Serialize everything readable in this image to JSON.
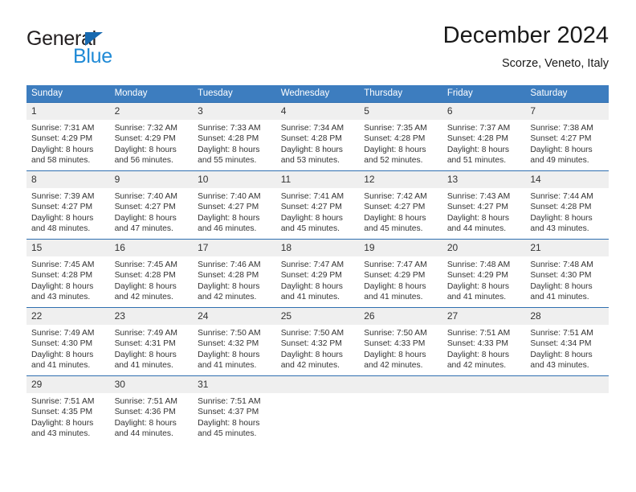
{
  "brand": {
    "name_part1": "General",
    "name_part2": "Blue",
    "triangle_color": "#1769b0",
    "blue_text_color": "#1f8ad6"
  },
  "header": {
    "title": "December 2024",
    "subtitle": "Scorze, Veneto, Italy"
  },
  "theme": {
    "header_bg": "#3d7dbf",
    "row_border": "#2f6fb0",
    "daynum_bg": "#efefef",
    "text": "#333333"
  },
  "weekday_headers": [
    "Sunday",
    "Monday",
    "Tuesday",
    "Wednesday",
    "Thursday",
    "Friday",
    "Saturday"
  ],
  "weeks": [
    [
      {
        "day": "1",
        "sunrise": "Sunrise: 7:31 AM",
        "sunset": "Sunset: 4:29 PM",
        "daylight1": "Daylight: 8 hours",
        "daylight2": "and 58 minutes."
      },
      {
        "day": "2",
        "sunrise": "Sunrise: 7:32 AM",
        "sunset": "Sunset: 4:29 PM",
        "daylight1": "Daylight: 8 hours",
        "daylight2": "and 56 minutes."
      },
      {
        "day": "3",
        "sunrise": "Sunrise: 7:33 AM",
        "sunset": "Sunset: 4:28 PM",
        "daylight1": "Daylight: 8 hours",
        "daylight2": "and 55 minutes."
      },
      {
        "day": "4",
        "sunrise": "Sunrise: 7:34 AM",
        "sunset": "Sunset: 4:28 PM",
        "daylight1": "Daylight: 8 hours",
        "daylight2": "and 53 minutes."
      },
      {
        "day": "5",
        "sunrise": "Sunrise: 7:35 AM",
        "sunset": "Sunset: 4:28 PM",
        "daylight1": "Daylight: 8 hours",
        "daylight2": "and 52 minutes."
      },
      {
        "day": "6",
        "sunrise": "Sunrise: 7:37 AM",
        "sunset": "Sunset: 4:28 PM",
        "daylight1": "Daylight: 8 hours",
        "daylight2": "and 51 minutes."
      },
      {
        "day": "7",
        "sunrise": "Sunrise: 7:38 AM",
        "sunset": "Sunset: 4:27 PM",
        "daylight1": "Daylight: 8 hours",
        "daylight2": "and 49 minutes."
      }
    ],
    [
      {
        "day": "8",
        "sunrise": "Sunrise: 7:39 AM",
        "sunset": "Sunset: 4:27 PM",
        "daylight1": "Daylight: 8 hours",
        "daylight2": "and 48 minutes."
      },
      {
        "day": "9",
        "sunrise": "Sunrise: 7:40 AM",
        "sunset": "Sunset: 4:27 PM",
        "daylight1": "Daylight: 8 hours",
        "daylight2": "and 47 minutes."
      },
      {
        "day": "10",
        "sunrise": "Sunrise: 7:40 AM",
        "sunset": "Sunset: 4:27 PM",
        "daylight1": "Daylight: 8 hours",
        "daylight2": "and 46 minutes."
      },
      {
        "day": "11",
        "sunrise": "Sunrise: 7:41 AM",
        "sunset": "Sunset: 4:27 PM",
        "daylight1": "Daylight: 8 hours",
        "daylight2": "and 45 minutes."
      },
      {
        "day": "12",
        "sunrise": "Sunrise: 7:42 AM",
        "sunset": "Sunset: 4:27 PM",
        "daylight1": "Daylight: 8 hours",
        "daylight2": "and 45 minutes."
      },
      {
        "day": "13",
        "sunrise": "Sunrise: 7:43 AM",
        "sunset": "Sunset: 4:27 PM",
        "daylight1": "Daylight: 8 hours",
        "daylight2": "and 44 minutes."
      },
      {
        "day": "14",
        "sunrise": "Sunrise: 7:44 AM",
        "sunset": "Sunset: 4:28 PM",
        "daylight1": "Daylight: 8 hours",
        "daylight2": "and 43 minutes."
      }
    ],
    [
      {
        "day": "15",
        "sunrise": "Sunrise: 7:45 AM",
        "sunset": "Sunset: 4:28 PM",
        "daylight1": "Daylight: 8 hours",
        "daylight2": "and 43 minutes."
      },
      {
        "day": "16",
        "sunrise": "Sunrise: 7:45 AM",
        "sunset": "Sunset: 4:28 PM",
        "daylight1": "Daylight: 8 hours",
        "daylight2": "and 42 minutes."
      },
      {
        "day": "17",
        "sunrise": "Sunrise: 7:46 AM",
        "sunset": "Sunset: 4:28 PM",
        "daylight1": "Daylight: 8 hours",
        "daylight2": "and 42 minutes."
      },
      {
        "day": "18",
        "sunrise": "Sunrise: 7:47 AM",
        "sunset": "Sunset: 4:29 PM",
        "daylight1": "Daylight: 8 hours",
        "daylight2": "and 41 minutes."
      },
      {
        "day": "19",
        "sunrise": "Sunrise: 7:47 AM",
        "sunset": "Sunset: 4:29 PM",
        "daylight1": "Daylight: 8 hours",
        "daylight2": "and 41 minutes."
      },
      {
        "day": "20",
        "sunrise": "Sunrise: 7:48 AM",
        "sunset": "Sunset: 4:29 PM",
        "daylight1": "Daylight: 8 hours",
        "daylight2": "and 41 minutes."
      },
      {
        "day": "21",
        "sunrise": "Sunrise: 7:48 AM",
        "sunset": "Sunset: 4:30 PM",
        "daylight1": "Daylight: 8 hours",
        "daylight2": "and 41 minutes."
      }
    ],
    [
      {
        "day": "22",
        "sunrise": "Sunrise: 7:49 AM",
        "sunset": "Sunset: 4:30 PM",
        "daylight1": "Daylight: 8 hours",
        "daylight2": "and 41 minutes."
      },
      {
        "day": "23",
        "sunrise": "Sunrise: 7:49 AM",
        "sunset": "Sunset: 4:31 PM",
        "daylight1": "Daylight: 8 hours",
        "daylight2": "and 41 minutes."
      },
      {
        "day": "24",
        "sunrise": "Sunrise: 7:50 AM",
        "sunset": "Sunset: 4:32 PM",
        "daylight1": "Daylight: 8 hours",
        "daylight2": "and 41 minutes."
      },
      {
        "day": "25",
        "sunrise": "Sunrise: 7:50 AM",
        "sunset": "Sunset: 4:32 PM",
        "daylight1": "Daylight: 8 hours",
        "daylight2": "and 42 minutes."
      },
      {
        "day": "26",
        "sunrise": "Sunrise: 7:50 AM",
        "sunset": "Sunset: 4:33 PM",
        "daylight1": "Daylight: 8 hours",
        "daylight2": "and 42 minutes."
      },
      {
        "day": "27",
        "sunrise": "Sunrise: 7:51 AM",
        "sunset": "Sunset: 4:33 PM",
        "daylight1": "Daylight: 8 hours",
        "daylight2": "and 42 minutes."
      },
      {
        "day": "28",
        "sunrise": "Sunrise: 7:51 AM",
        "sunset": "Sunset: 4:34 PM",
        "daylight1": "Daylight: 8 hours",
        "daylight2": "and 43 minutes."
      }
    ],
    [
      {
        "day": "29",
        "sunrise": "Sunrise: 7:51 AM",
        "sunset": "Sunset: 4:35 PM",
        "daylight1": "Daylight: 8 hours",
        "daylight2": "and 43 minutes."
      },
      {
        "day": "30",
        "sunrise": "Sunrise: 7:51 AM",
        "sunset": "Sunset: 4:36 PM",
        "daylight1": "Daylight: 8 hours",
        "daylight2": "and 44 minutes."
      },
      {
        "day": "31",
        "sunrise": "Sunrise: 7:51 AM",
        "sunset": "Sunset: 4:37 PM",
        "daylight1": "Daylight: 8 hours",
        "daylight2": "and 45 minutes."
      },
      {
        "day": "",
        "sunrise": "",
        "sunset": "",
        "daylight1": "",
        "daylight2": ""
      },
      {
        "day": "",
        "sunrise": "",
        "sunset": "",
        "daylight1": "",
        "daylight2": ""
      },
      {
        "day": "",
        "sunrise": "",
        "sunset": "",
        "daylight1": "",
        "daylight2": ""
      },
      {
        "day": "",
        "sunrise": "",
        "sunset": "",
        "daylight1": "",
        "daylight2": ""
      }
    ]
  ]
}
